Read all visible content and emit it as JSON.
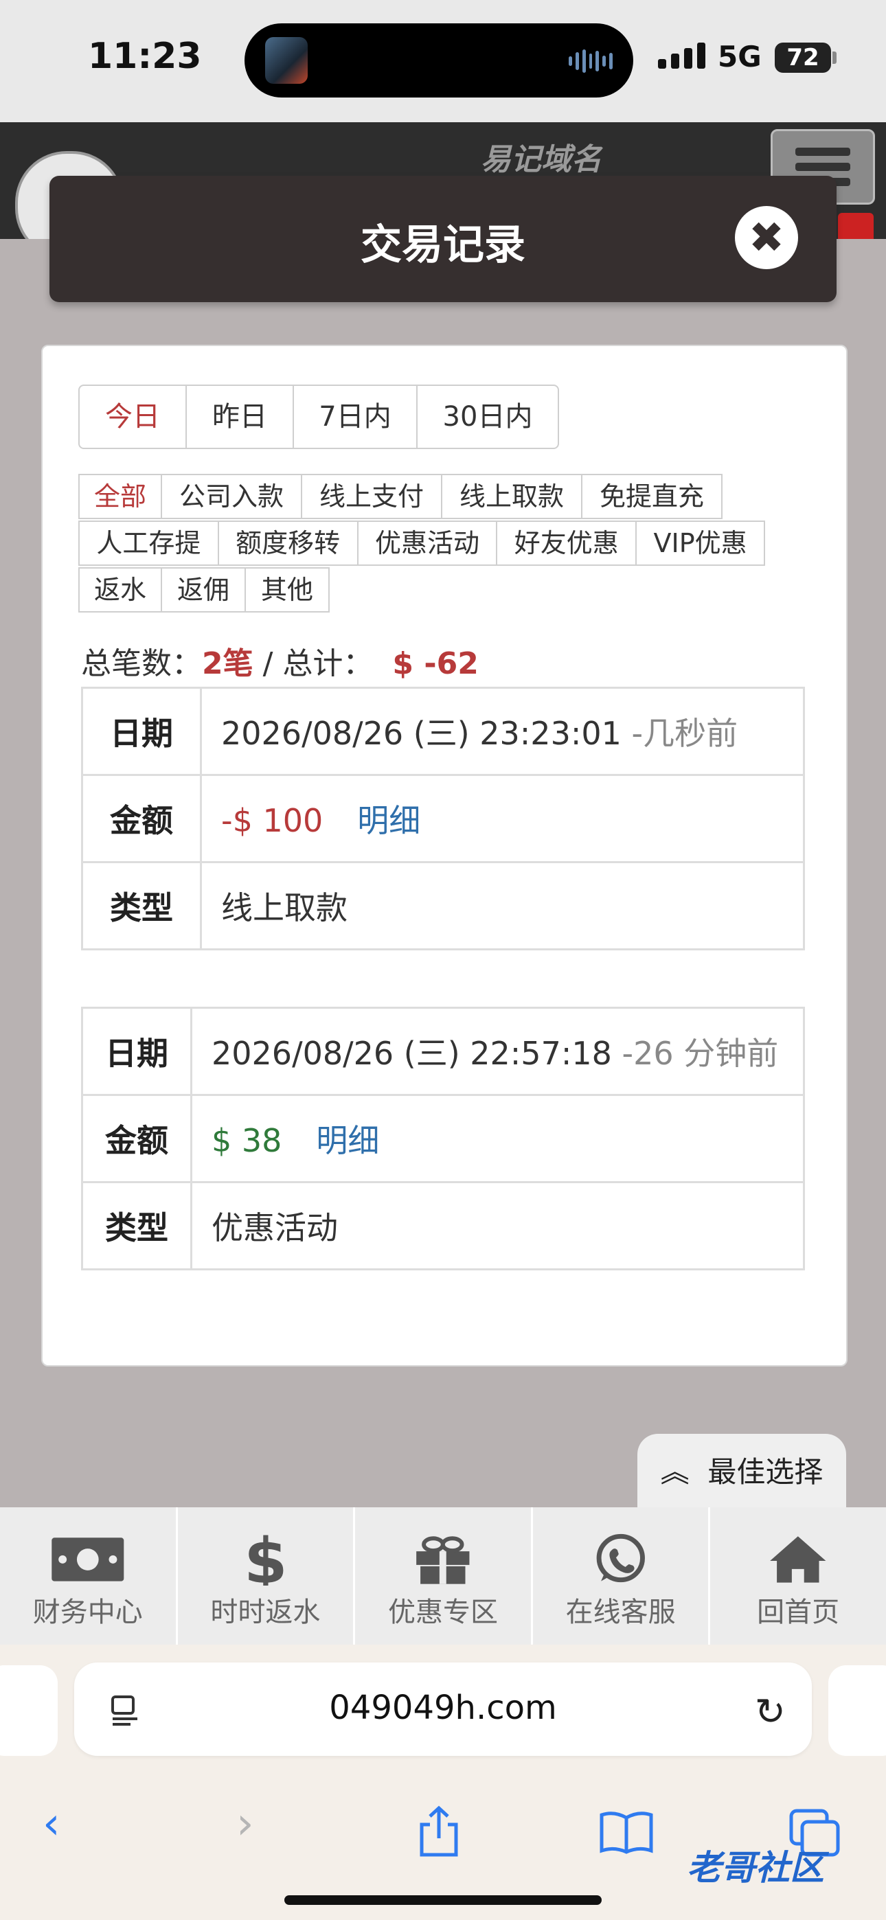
{
  "status_bar": {
    "time": "11:23",
    "network": "5G",
    "battery": "72"
  },
  "site_header": {
    "slogan": "易记域名"
  },
  "modal": {
    "title": "交易记录",
    "close_symbol": "✖"
  },
  "date_tabs": [
    {
      "label": "今日",
      "active": true
    },
    {
      "label": "昨日",
      "active": false
    },
    {
      "label": "7日内",
      "active": false
    },
    {
      "label": "30日内",
      "active": false
    }
  ],
  "type_filters": {
    "row1": [
      "全部",
      "公司入款",
      "线上支付",
      "线上取款",
      "免提直充"
    ],
    "row2": [
      "人工存提",
      "额度移转",
      "优惠活动",
      "好友优惠",
      "VIP优惠"
    ],
    "row3": [
      "返水",
      "返佣",
      "其他"
    ],
    "active": "全部"
  },
  "summary": {
    "count_label": "总笔数：",
    "count_value": "2笔",
    "sep": " / ",
    "total_label": "总计：",
    "total_value": "$ -62"
  },
  "records": [
    {
      "date_label": "日期",
      "date": "2026/08/26 (三) 23:23:01",
      "ago": "-几秒前",
      "amount_label": "金额",
      "amount": "-$ 100",
      "detail": "明细",
      "type_label": "类型",
      "type": "线上取款"
    },
    {
      "date_label": "日期",
      "date": "2026/08/26 (三) 22:57:18",
      "ago": "-26 分钟前",
      "amount_label": "金额",
      "amount": "$ 38",
      "detail": "明细",
      "type_label": "类型",
      "type": "优惠活动"
    }
  ],
  "best_choice": {
    "icon": "chevron-up-icon",
    "label": "最佳选择"
  },
  "bottom_nav": [
    {
      "label": "财务中心",
      "icon": "money-icon"
    },
    {
      "label": "时时返水",
      "icon": "dollar-icon"
    },
    {
      "label": "优惠专区",
      "icon": "gift-icon"
    },
    {
      "label": "在线客服",
      "icon": "whatsapp-icon"
    },
    {
      "label": "回首页",
      "icon": "home-icon"
    }
  ],
  "browser": {
    "url": "049049h.com"
  },
  "watermark": "老哥社区",
  "colors": {
    "accent_red": "#b73a3a",
    "positive_green": "#2f7a3a",
    "link_blue": "#2f6fab",
    "modal_header": "#362f2f"
  }
}
